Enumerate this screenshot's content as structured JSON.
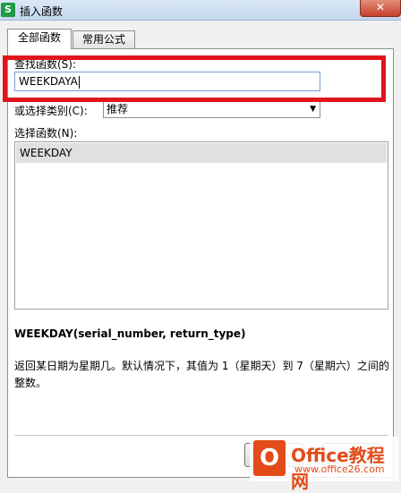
{
  "window": {
    "title": "插入函数",
    "app_icon": "S",
    "close_glyph": "✕"
  },
  "tabs": [
    {
      "label": "全部函数",
      "active": true
    },
    {
      "label": "常用公式",
      "active": false
    }
  ],
  "search": {
    "label": "查找函数(S):",
    "value": "WEEKDAYA"
  },
  "category": {
    "label": "或选择类别(C):",
    "selected": "推荐"
  },
  "function_list": {
    "label": "选择函数(N):",
    "items": [
      "WEEKDAY"
    ]
  },
  "syntax": "WEEKDAY(serial_number, return_type)",
  "description": "返回某日期为星期几。默认情况下，其值为 1（星期天）到 7（星期六）之间的整数。",
  "watermark": {
    "logo_letter": "O",
    "name": "Office教程网",
    "url": "www.office26.com"
  },
  "colors": {
    "highlight": "#e2141b",
    "accent": "#7a9cd3"
  }
}
